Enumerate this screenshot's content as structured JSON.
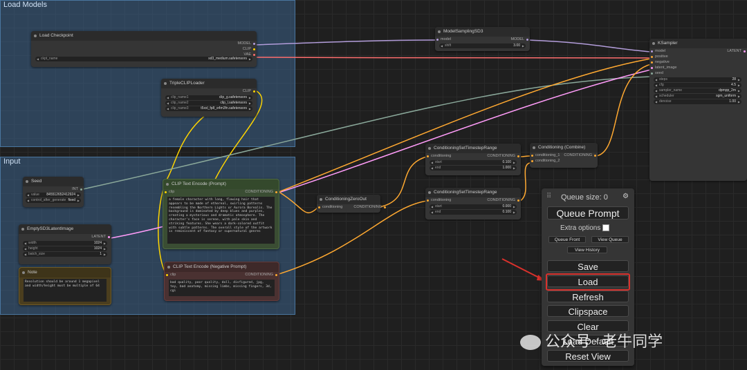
{
  "groups": {
    "load_models": "Load Models",
    "input": "Input"
  },
  "nodes": {
    "load_checkpoint": {
      "title": "Load Checkpoint",
      "outputs": [
        "MODEL",
        "CLIP",
        "VAE"
      ],
      "ckpt_label": "ckpt_name",
      "ckpt_value": "sd3_medium.safetensors"
    },
    "triple_clip": {
      "title": "TripleCLIPLoader",
      "output": "CLIP",
      "widgets": [
        {
          "label": "clip_name1",
          "value": "clip_g.safetensors"
        },
        {
          "label": "clip_name2",
          "value": "clip_l.safetensors"
        },
        {
          "label": "clip_name3",
          "value": "t5xxl_fp8_e4m3fn.safetensors"
        }
      ]
    },
    "model_sampling": {
      "title": "ModelSamplingSD3",
      "input": "model",
      "output": "MODEL",
      "shift_label": "shift",
      "shift_value": "3.00"
    },
    "ksampler": {
      "title": "KSampler",
      "inputs": [
        "model",
        "positive",
        "negative",
        "latent_image",
        "seed"
      ],
      "output": "LATENT",
      "widgets": [
        {
          "label": "steps",
          "value": "28"
        },
        {
          "label": "cfg",
          "value": "4.5"
        },
        {
          "label": "sampler_name",
          "value": "dpmpp_2m"
        },
        {
          "label": "scheduler",
          "value": "sgm_uniform"
        },
        {
          "label": "denoise",
          "value": "1.00"
        }
      ]
    },
    "seed": {
      "title": "Seed",
      "output": "INT",
      "widgets": [
        {
          "label": "value",
          "value": "845512652412924"
        },
        {
          "label": "control_after_generate",
          "value": "fixed"
        }
      ]
    },
    "empty_latent": {
      "title": "EmptySD3LatentImage",
      "output": "LATENT",
      "widgets": [
        {
          "label": "width",
          "value": "1024"
        },
        {
          "label": "height",
          "value": "1024"
        },
        {
          "label": "batch_size",
          "value": "1"
        }
      ]
    },
    "note": {
      "title": "Note",
      "text": "Resolution should be around 1 megapixel and width/height must be multiple of 64"
    },
    "clip_pos": {
      "title": "CLIP Text Encode (Prompt)",
      "input": "clip",
      "output": "CONDITIONING",
      "text": "a female character with long, flowing hair that appears to be made of ethereal, swirling patterns resembling the Northern Lights or Aurora Borealis. The background is dominated by deep blues and purples, creating a mysterious and dramatic atmosphere. The character's face is serene, with pale skin and striking features. She wears a dark-colored outfit with subtle patterns. The overall style of the artwork is reminiscent of fantasy or supernatural genres"
    },
    "clip_neg": {
      "title": "CLIP Text Encode (Negative Prompt)",
      "input": "clip",
      "output": "CONDITIONING",
      "text": "bad quality, poor quality, doll, disfigured, jpg, toy, bad anatomy, missing limbs, missing fingers, 3d, cgi"
    },
    "zero_out": {
      "title": "ConditioningZeroOut",
      "input": "conditioning",
      "output": "CONDITIONING"
    },
    "timestep1": {
      "title": "ConditioningSetTimestepRange",
      "input": "conditioning",
      "output": "CONDITIONING",
      "widgets": [
        {
          "label": "start",
          "value": "0.100"
        },
        {
          "label": "end",
          "value": "1.000"
        }
      ]
    },
    "timestep2": {
      "title": "ConditioningSetTimestepRange",
      "input": "conditioning",
      "output": "CONDITIONING",
      "widgets": [
        {
          "label": "start",
          "value": "0.000"
        },
        {
          "label": "end",
          "value": "0.100"
        }
      ]
    },
    "combine": {
      "title": "Conditioning (Combine)",
      "inputs": [
        "conditioning_1",
        "conditioning_2"
      ],
      "output": "CONDITIONING"
    }
  },
  "queue": {
    "size_label": "Queue size: 0",
    "queue_prompt": "Queue Prompt",
    "extra_options": "Extra options",
    "queue_front": "Queue Front",
    "view_queue": "View Queue",
    "view_history": "View History",
    "save": "Save",
    "load": "Load",
    "refresh": "Refresh",
    "clipspace": "Clipspace",
    "clear": "Clear",
    "load_default": "Load Default",
    "reset_view": "Reset View"
  },
  "watermark": {
    "channel": "公众号",
    "dot": "·",
    "author": "老牛同学"
  },
  "colors": {
    "model_wire": "#b39ddb",
    "vae_wire": "#ff6e6e",
    "clip_wire": "#ffd500",
    "conditioning_wire": "#ffa931",
    "latent_wire": "#ff9cf9",
    "int_wire": "#8aa89a",
    "highlight": "#d9312c"
  }
}
